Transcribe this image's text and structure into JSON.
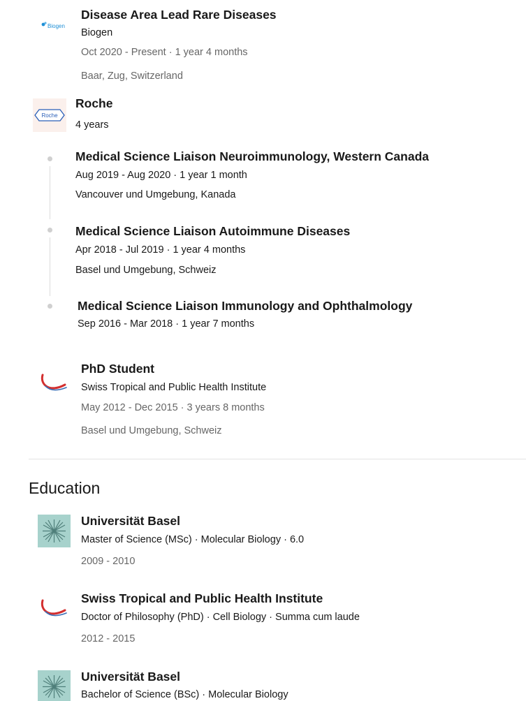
{
  "experience": {
    "biogen": {
      "title": "Disease Area Lead Rare Diseases",
      "company": "Biogen",
      "dates": "Oct 2020 - Present · 1 year 4 months",
      "location": "Baar, Zug, Switzerland",
      "logo_text": "Biogen",
      "logo_color": "#1e8fd6"
    },
    "roche": {
      "company": "Roche",
      "duration": "4 years",
      "logo_text": "Roche",
      "logo_color": "#2a5fb8",
      "roles": [
        {
          "title": "Medical Science Liaison Neuroimmunology, Western Canada",
          "dates": "Aug 2019 - Aug 2020 · 1 year 1 month",
          "location": "Vancouver und Umgebung, Kanada"
        },
        {
          "title": "Medical Science Liaison Autoimmune Diseases",
          "dates": "Apr 2018 - Jul 2019 · 1 year 4 months",
          "location": "Basel und Umgebung, Schweiz"
        },
        {
          "title": "Medical Science Liaison Immunology and Ophthalmology",
          "dates": "Sep 2016 - Mar 2018 · 1 year 7 months"
        }
      ]
    },
    "phd": {
      "title": "PhD Student",
      "company": "Swiss Tropical and Public Health Institute",
      "dates": "May 2012 - Dec 2015 · 3 years 8 months",
      "location": "Basel und Umgebung, Schweiz"
    }
  },
  "education": {
    "heading": "Education",
    "items": [
      {
        "school": "Universität Basel",
        "degree": "Master of Science (MSc) · Molecular Biology · 6.0",
        "years": "2009 - 2010"
      },
      {
        "school": "Swiss Tropical and Public Health Institute",
        "degree": "Doctor of Philosophy (PhD) · Cell Biology · Summa cum laude",
        "years": "2012 - 2015"
      },
      {
        "school": "Universität Basel",
        "degree": "Bachelor of Science (BSc) · Molecular Biology"
      }
    ]
  },
  "colors": {
    "unibas_bg": "#a7d2cc",
    "tph_red": "#d32f2f",
    "tph_blue": "#3b6fb6"
  }
}
